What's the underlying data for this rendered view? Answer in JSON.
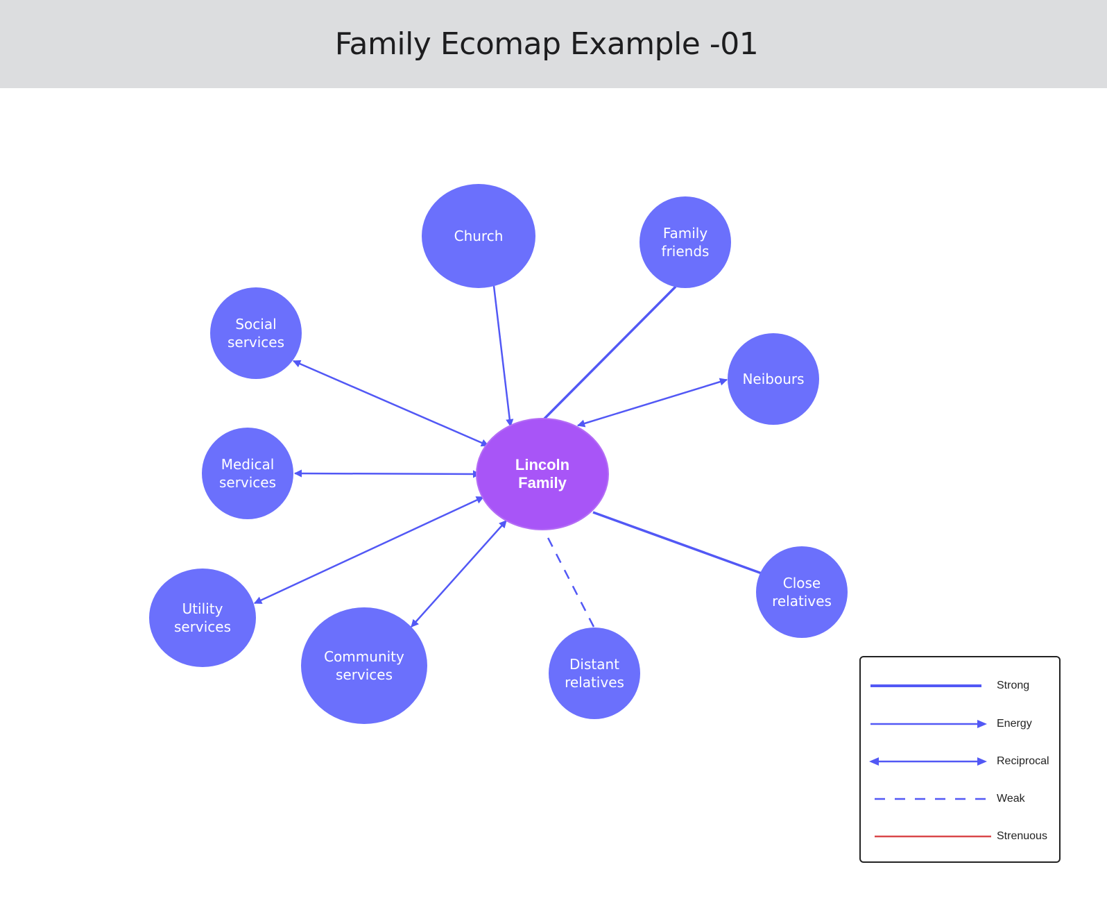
{
  "header": {
    "title": "Family Ecomap Example -01"
  },
  "colors": {
    "node_fill": "#6b70fc",
    "center_fill": "#a855f7",
    "center_stroke": "#b46df5",
    "edge": "#5258f5",
    "strenuous": "#d9484a",
    "header_bg": "#dcdddf"
  },
  "center": {
    "id": "lincoln",
    "label_lines": [
      "Lincoln",
      "Family"
    ]
  },
  "nodes": [
    {
      "id": "church",
      "label_lines": [
        "Church"
      ],
      "relation": "energy",
      "direction": "to-family"
    },
    {
      "id": "family-friends",
      "label_lines": [
        "Family",
        "friends"
      ],
      "relation": "strong",
      "direction": "none"
    },
    {
      "id": "neibours",
      "label_lines": [
        "Neibours"
      ],
      "relation": "reciprocal",
      "direction": "both"
    },
    {
      "id": "social-services",
      "label_lines": [
        "Social",
        "services"
      ],
      "relation": "reciprocal",
      "direction": "both"
    },
    {
      "id": "medical-services",
      "label_lines": [
        "Medical",
        "services"
      ],
      "relation": "reciprocal",
      "direction": "both"
    },
    {
      "id": "utility-services",
      "label_lines": [
        "Utility",
        "services"
      ],
      "relation": "reciprocal",
      "direction": "both"
    },
    {
      "id": "community-services",
      "label_lines": [
        "Community",
        "services"
      ],
      "relation": "reciprocal",
      "direction": "both"
    },
    {
      "id": "distant-relatives",
      "label_lines": [
        "Distant",
        "relatives"
      ],
      "relation": "weak",
      "direction": "none"
    },
    {
      "id": "close-relatives",
      "label_lines": [
        "Close",
        "relatives"
      ],
      "relation": "strong",
      "direction": "none"
    }
  ],
  "legend": {
    "items": [
      {
        "type": "strong",
        "label": "Strong"
      },
      {
        "type": "energy",
        "label": "Energy"
      },
      {
        "type": "reciprocal",
        "label": "Reciprocal"
      },
      {
        "type": "weak",
        "label": "Weak"
      },
      {
        "type": "strenuous",
        "label": "Strenuous"
      }
    ]
  }
}
